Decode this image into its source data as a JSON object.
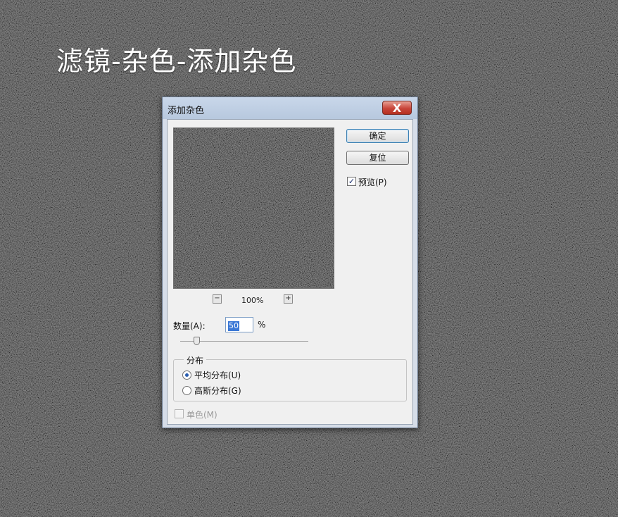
{
  "page": {
    "title": "滤镜-杂色-添加杂色"
  },
  "dialog": {
    "title": "添加杂色",
    "close_label": "X",
    "ok_label": "确定",
    "reset_label": "复位",
    "preview": {
      "label": "预览(P)",
      "checked": true
    },
    "zoom": {
      "minus": "−",
      "plus": "+",
      "level": "100%"
    },
    "amount": {
      "label": "数量(A):",
      "value": "50",
      "unit": "%"
    },
    "distribution": {
      "legend": "分布",
      "uniform_label": "平均分布(U)",
      "gaussian_label": "高斯分布(G)",
      "selected": "uniform"
    },
    "monochromatic": {
      "label": "单色(M)",
      "checked": false,
      "enabled": false
    }
  },
  "colors": {
    "background": "#2a2a2a",
    "dialog_frame": "#d6dde8",
    "close_button": "#c8453a",
    "selection": "#3b78d6"
  }
}
